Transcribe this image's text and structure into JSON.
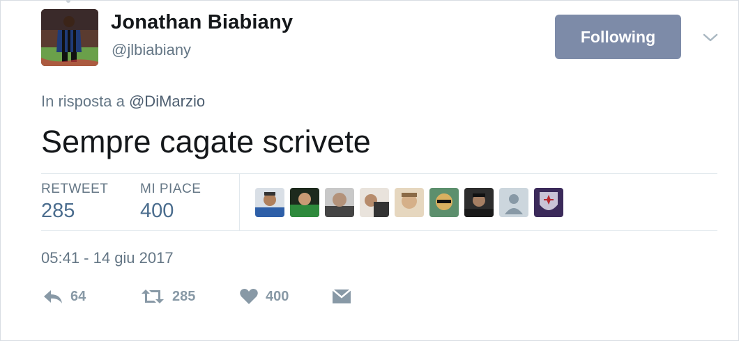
{
  "author": {
    "name": "Jonathan Biabiany",
    "handle": "@jlbiabiany",
    "avatar_icon": "profile-photo"
  },
  "follow_button": {
    "label": "Following",
    "color": "#7d8ba8"
  },
  "menu": {
    "icon": "chevron-down-icon"
  },
  "reply": {
    "prefix": "In risposta a",
    "mention": "@DiMarzio"
  },
  "tweet": {
    "text": "Sempre cagate scrivete"
  },
  "stats": {
    "retweet_label": "RETWEET",
    "retweet_count": "285",
    "likes_label": "MI PIACE",
    "likes_count": "400"
  },
  "likers": [
    {
      "icon": "user-avatar"
    },
    {
      "icon": "user-avatar"
    },
    {
      "icon": "user-avatar"
    },
    {
      "icon": "user-avatar"
    },
    {
      "icon": "user-avatar"
    },
    {
      "icon": "user-avatar"
    },
    {
      "icon": "user-avatar"
    },
    {
      "icon": "default-egg-avatar"
    },
    {
      "icon": "fiorentina-logo-avatar"
    }
  ],
  "timestamp": "05:41 - 14 giu 2017",
  "actions": {
    "reply_count": "64",
    "retweet_count": "285",
    "like_count": "400",
    "dm_icon": "envelope-icon"
  }
}
